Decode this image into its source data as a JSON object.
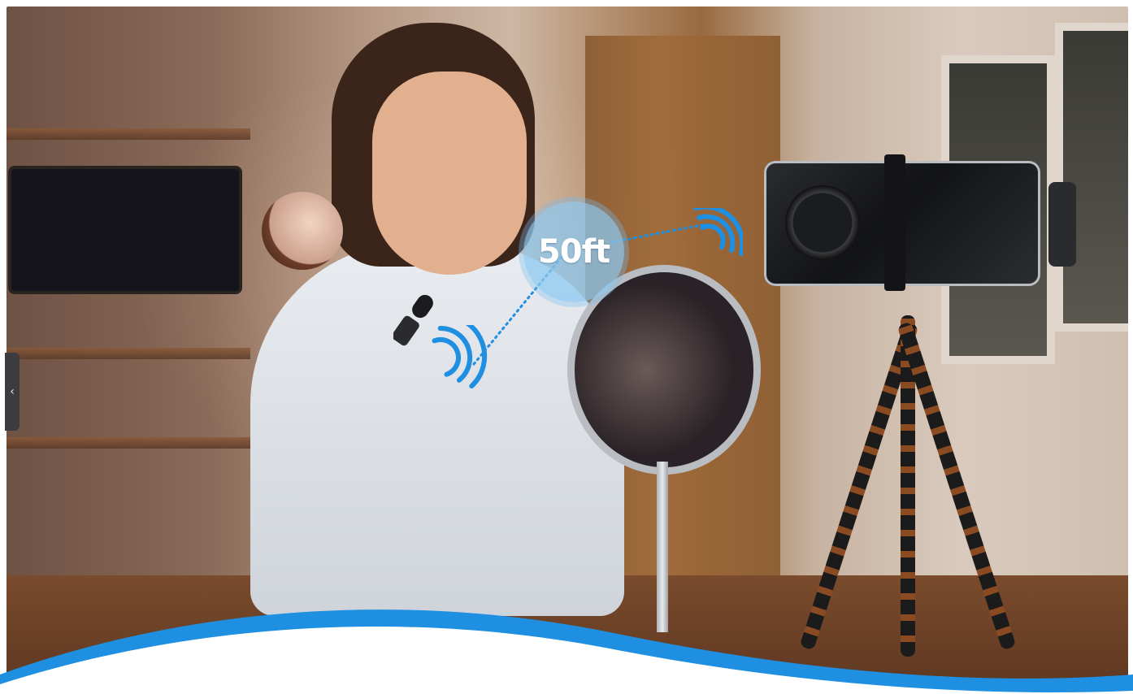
{
  "overlay": {
    "distance_label": "50ft",
    "accent_color": "#1E8FE1",
    "circle_color": "#8CC8F0"
  },
  "carousel": {
    "prev_icon": "chevron-left-icon",
    "prev_glyph": "‹"
  },
  "icons": {
    "mic_signal": "wifi-signal-icon",
    "receiver_signal": "wifi-signal-icon"
  },
  "colors": {
    "wave_blue": "#1E8FE1",
    "wave_white": "#FFFFFF"
  }
}
